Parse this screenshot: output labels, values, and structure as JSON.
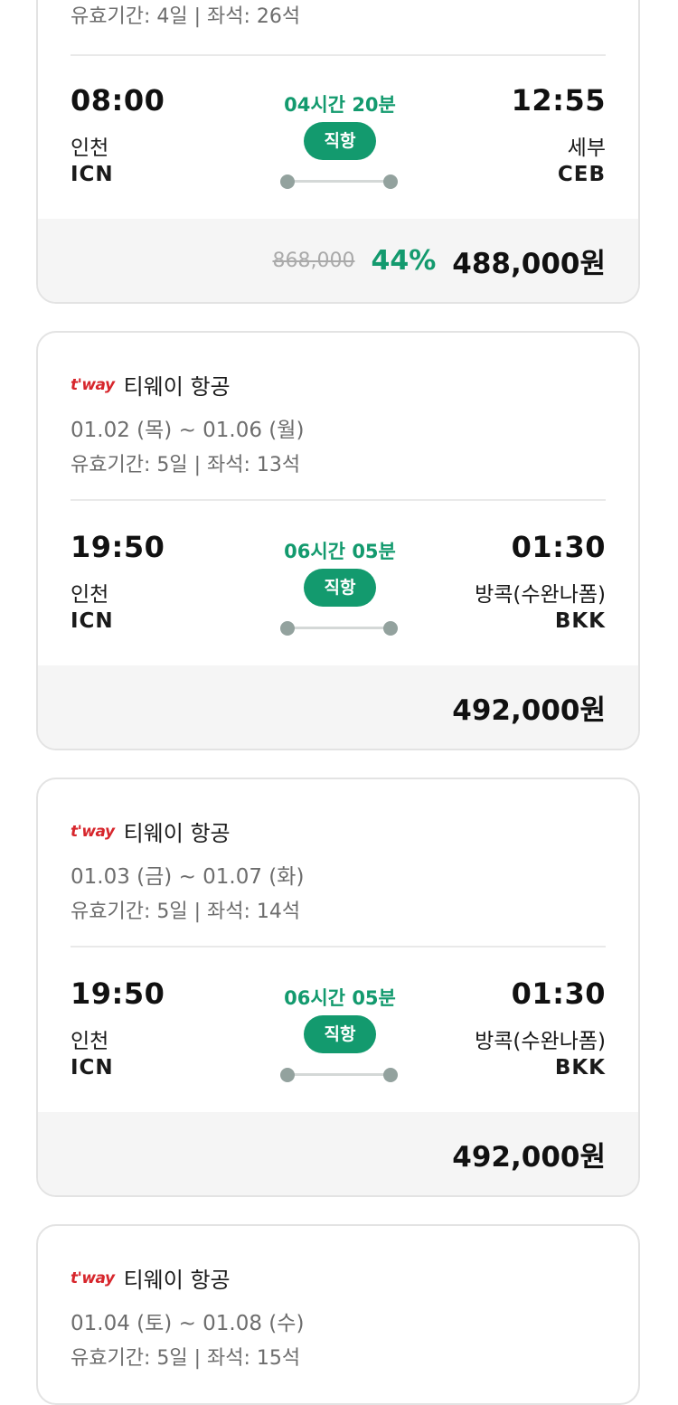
{
  "cards": [
    {
      "validity": "유효기간: 4일 | 좌석: 26석",
      "dep_time": "08:00",
      "dep_city": "인천",
      "dep_code": "ICN",
      "duration": "04시간 20분",
      "flight_type": "직항",
      "arr_time": "12:55",
      "arr_city": "세부",
      "arr_code": "CEB",
      "orig_price": "868,000",
      "discount": "44%",
      "price": "488,000원"
    },
    {
      "airline_logo": "t'way",
      "airline_name": "티웨이 항공",
      "dates": "01.02 (목) ~ 01.06 (월)",
      "validity": "유효기간: 5일 | 좌석: 13석",
      "dep_time": "19:50",
      "dep_city": "인천",
      "dep_code": "ICN",
      "duration": "06시간 05분",
      "flight_type": "직항",
      "arr_time": "01:30",
      "arr_city": "방콕(수완나폼)",
      "arr_code": "BKK",
      "price": "492,000원"
    },
    {
      "airline_logo": "t'way",
      "airline_name": "티웨이 항공",
      "dates": "01.03 (금) ~ 01.07 (화)",
      "validity": "유효기간: 5일 | 좌석: 14석",
      "dep_time": "19:50",
      "dep_city": "인천",
      "dep_code": "ICN",
      "duration": "06시간 05분",
      "flight_type": "직항",
      "arr_time": "01:30",
      "arr_city": "방콕(수완나폼)",
      "arr_code": "BKK",
      "price": "492,000원"
    },
    {
      "airline_logo": "t'way",
      "airline_name": "티웨이 항공",
      "dates": "01.04 (토) ~ 01.08 (수)",
      "validity": "유효기간: 5일 | 좌석: 15석"
    }
  ],
  "colors": {
    "accent": "#139a6e",
    "logo": "#d7262c",
    "route_dot": "#93a29e",
    "price_bg": "#f5f5f5"
  }
}
